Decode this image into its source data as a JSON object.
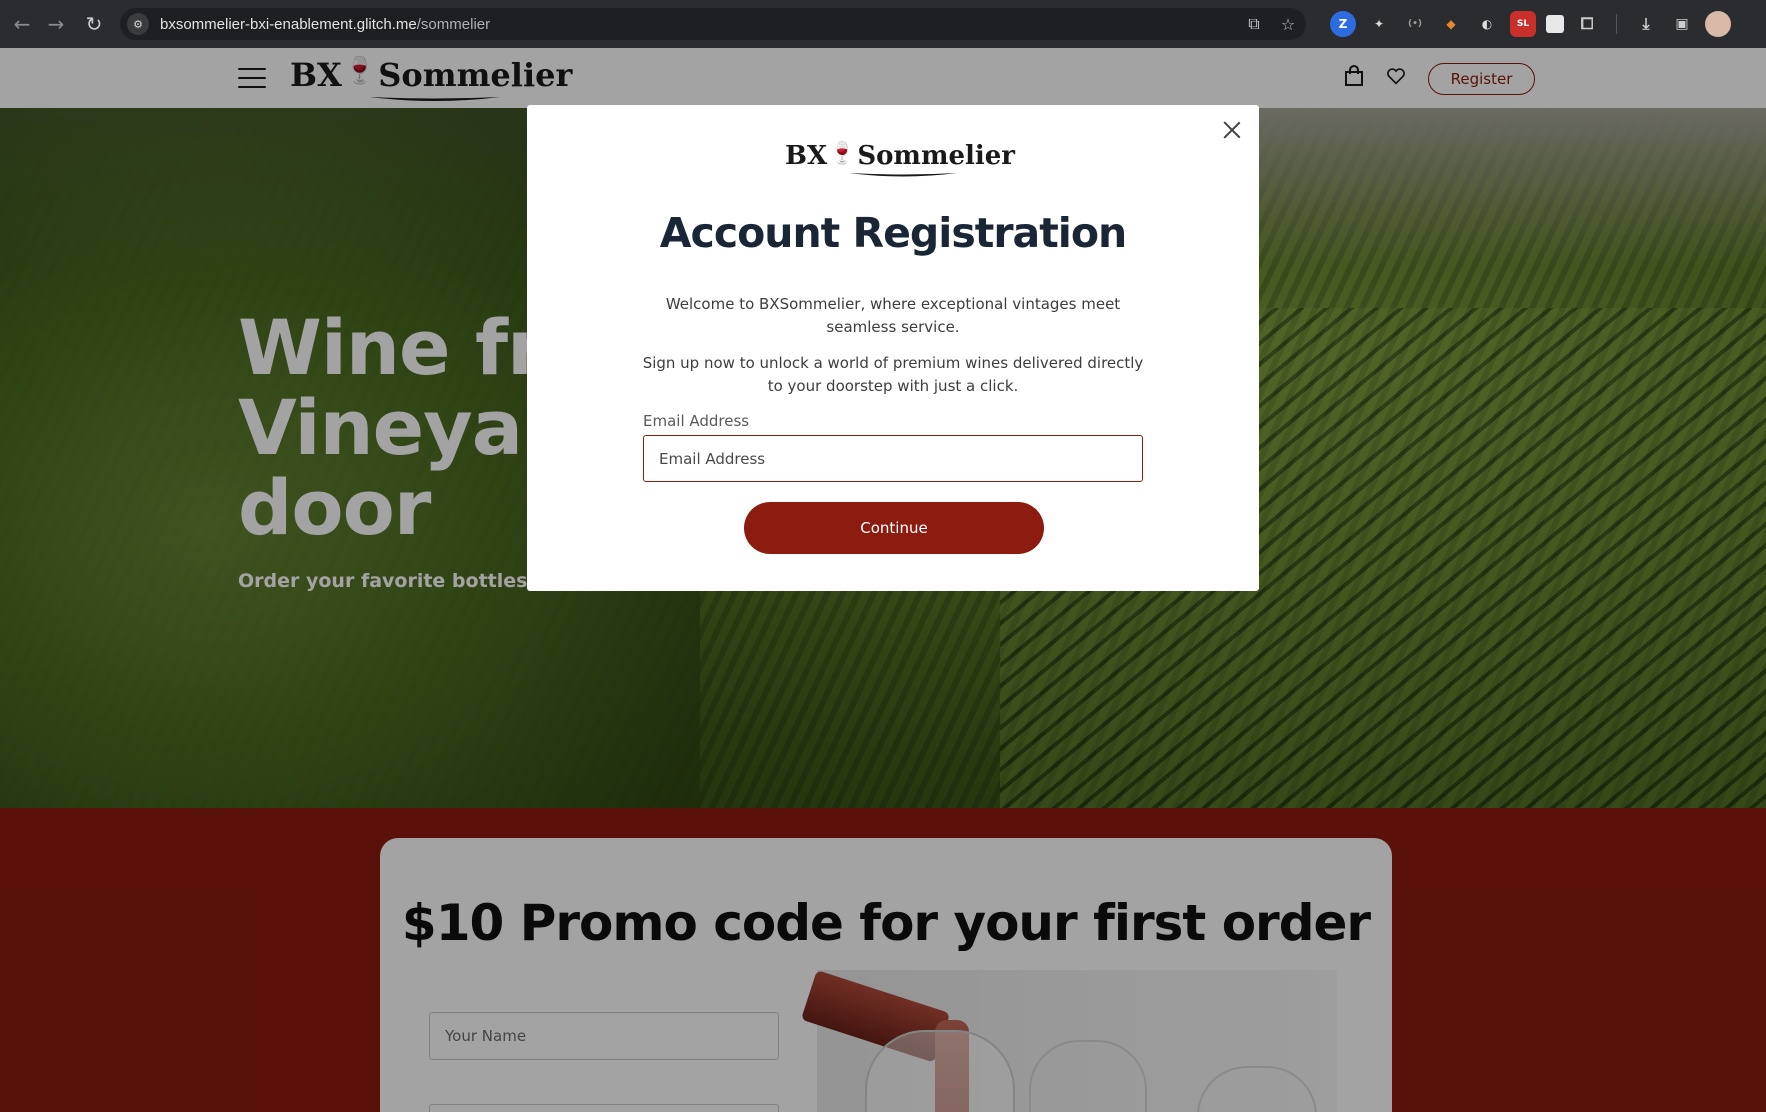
{
  "browser": {
    "url_host": "bxsommelier-bxi-enablement.glitch.me",
    "url_path": "/sommelier",
    "extensions": [
      {
        "icon": "zoom-extension-icon",
        "color": "#2d6cdf",
        "glyph": "Z"
      },
      {
        "icon": "cursor-extension-icon",
        "color": "#2b2c2f",
        "glyph": "✦"
      },
      {
        "icon": "wave-extension-icon",
        "color": "#2b2c2f",
        "glyph": "(•)"
      },
      {
        "icon": "puzzle-orange-extension-icon",
        "color": "#e58a2b",
        "glyph": "◆"
      },
      {
        "icon": "lens-extension-icon",
        "color": "#2b2c2f",
        "glyph": "◐"
      },
      {
        "icon": "red-square-extension-icon",
        "color": "#c9302c",
        "glyph": "SL"
      },
      {
        "icon": "white-square-extension-icon",
        "color": "#e8e8e8",
        "glyph": ""
      }
    ]
  },
  "header": {
    "logo_bx": "BX",
    "logo_sommelier": "Sommelier",
    "register_label": "Register"
  },
  "hero": {
    "title_line1": "Wine fro",
    "title_line2": "Vineyard",
    "title_line3": "door",
    "subtitle": "Order your favorite bottles onli"
  },
  "promo": {
    "title": "$10 Promo code for your first order",
    "name_placeholder": "Your Name"
  },
  "modal": {
    "logo_bx": "BX",
    "logo_sommelier": "Sommelier",
    "title": "Account Registration",
    "paragraph1": "Welcome to BXSommelier, where exceptional vintages meet seamless service.",
    "paragraph2": "Sign up now to unlock a world of premium wines delivered directly to your doorstep with just a click.",
    "email_label": "Email Address",
    "email_placeholder": "Email Address",
    "email_value": "",
    "continue_label": "Continue"
  },
  "colors": {
    "brand_red": "#8b1c0f",
    "title_navy": "#1a2535"
  }
}
